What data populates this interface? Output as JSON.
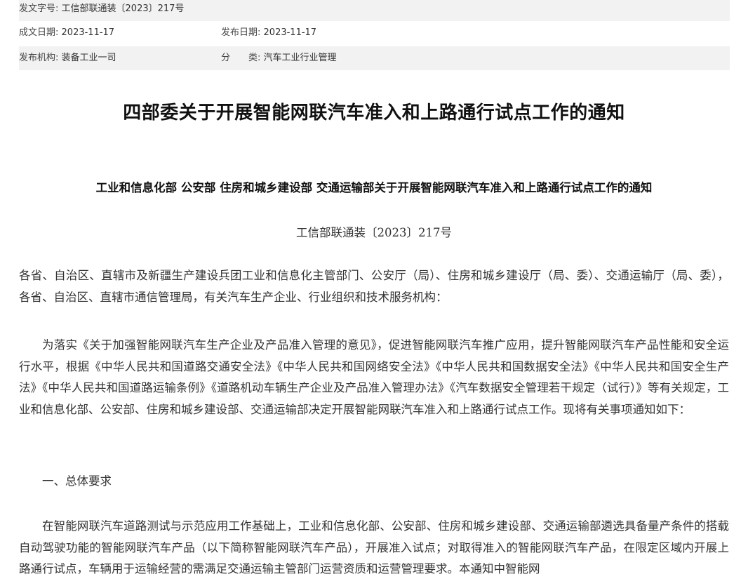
{
  "meta": {
    "doc_no_label": "发文字号:",
    "doc_no_value": "工信部联通装〔2023〕217号",
    "created_label": "成文日期:",
    "created_value": "2023-11-17",
    "published_label": "发布日期:",
    "published_value": "2023-11-17",
    "org_label": "发布机构:",
    "org_value": "装备工业一司",
    "category_label": "分　　类:",
    "category_value": "汽车工业行业管理"
  },
  "document": {
    "title": "四部委关于开展智能网联汽车准入和上路通行试点工作的通知",
    "subtitle": "工业和信息化部  公安部  住房和城乡建设部  交通运输部关于开展智能网联汽车准入和上路通行试点工作的通知",
    "doc_number": "工信部联通装〔2023〕217号",
    "addressees": "各省、自治区、直辖市及新疆生产建设兵团工业和信息化主管部门、公安厅（局）、住房和城乡建设厅（局、委）、交通运输厅（局、委），各省、自治区、直辖市通信管理局，有关汽车生产企业、行业组织和技术服务机构：",
    "intro": "为落实《关于加强智能网联汽车生产企业及产品准入管理的意见》，促进智能网联汽车推广应用，提升智能网联汽车产品性能和安全运行水平，根据《中华人民共和国道路交通安全法》《中华人民共和国网络安全法》《中华人民共和国数据安全法》《中华人民共和国安全生产法》《中华人民共和国道路运输条例》《道路机动车辆生产企业及产品准入管理办法》《汽车数据安全管理若干规定（试行）》等有关规定，工业和信息化部、公安部、住房和城乡建设部、交通运输部决定开展智能网联汽车准入和上路通行试点工作。现将有关事项通知如下：",
    "section1_heading": "一、总体要求",
    "section1_body": "在智能网联汽车道路测试与示范应用工作基础上，工业和信息化部、公安部、住房和城乡建设部、交通运输部遴选具备量产条件的搭载自动驾驶功能的智能网联汽车产品（以下简称智能网联汽车产品），开展准入试点；对取得准入的智能网联汽车产品，在限定区域内开展上路通行试点，车辆用于运输经营的需满足交通运输主管部门运营资质和运营管理要求。本通知中智能网"
  }
}
